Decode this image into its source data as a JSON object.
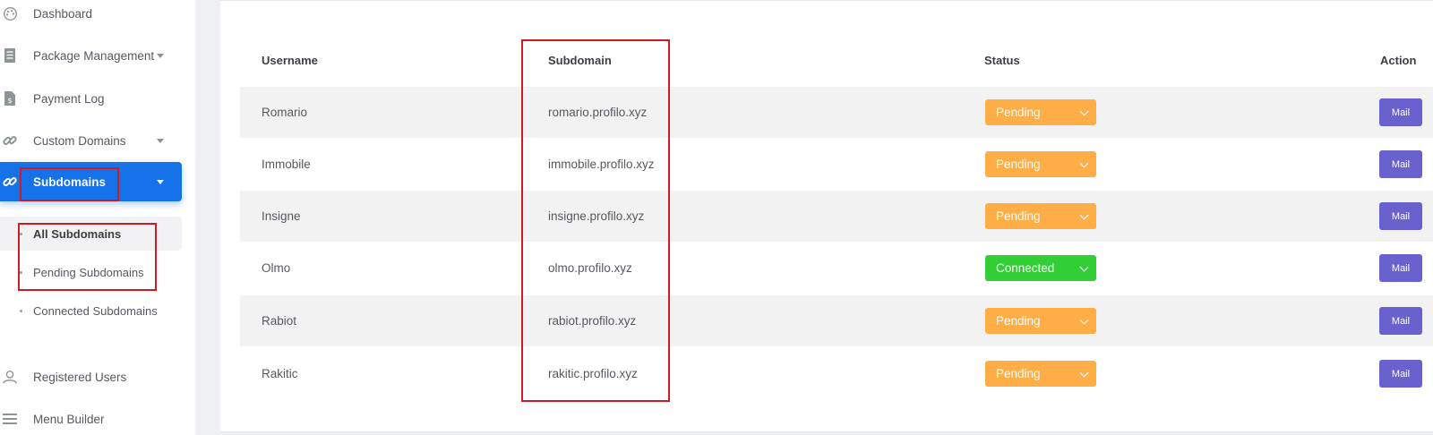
{
  "sidebar": {
    "items": [
      {
        "label": "Dashboard",
        "icon": "palette-icon"
      },
      {
        "label": "Package Management",
        "icon": "receipt-icon"
      },
      {
        "label": "Payment Log",
        "icon": "invoice-icon"
      },
      {
        "label": "Custom Domains",
        "icon": "link-icon"
      },
      {
        "label": "Subdomains",
        "icon": "link-icon"
      },
      {
        "label": "Registered Users",
        "icon": "users-icon"
      },
      {
        "label": "Menu Builder",
        "icon": "bars-icon"
      }
    ],
    "submenu": [
      {
        "label": "All Subdomains"
      },
      {
        "label": "Pending Subdomains"
      },
      {
        "label": "Connected Subdomains"
      }
    ]
  },
  "table": {
    "headers": {
      "username": "Username",
      "subdomain": "Subdomain",
      "status": "Status",
      "action": "Action"
    },
    "rows": [
      {
        "username": "Romario",
        "subdomain": "romario.profilo.xyz",
        "status": "Pending",
        "action": "Mail"
      },
      {
        "username": "Immobile",
        "subdomain": "immobile.profilo.xyz",
        "status": "Pending",
        "action": "Mail"
      },
      {
        "username": "Insigne",
        "subdomain": "insigne.profilo.xyz",
        "status": "Pending",
        "action": "Mail"
      },
      {
        "username": "Olmo",
        "subdomain": "olmo.profilo.xyz",
        "status": "Connected",
        "action": "Mail"
      },
      {
        "username": "Rabiot",
        "subdomain": "rabiot.profilo.xyz",
        "status": "Pending",
        "action": "Mail"
      },
      {
        "username": "Rakitic",
        "subdomain": "rakitic.profilo.xyz",
        "status": "Pending",
        "action": "Mail"
      }
    ]
  },
  "colors": {
    "primary": "#1572e8",
    "pending": "#ffad46",
    "connected": "#31ce36",
    "mail": "#6861ce",
    "highlight": "#cf1c24"
  }
}
